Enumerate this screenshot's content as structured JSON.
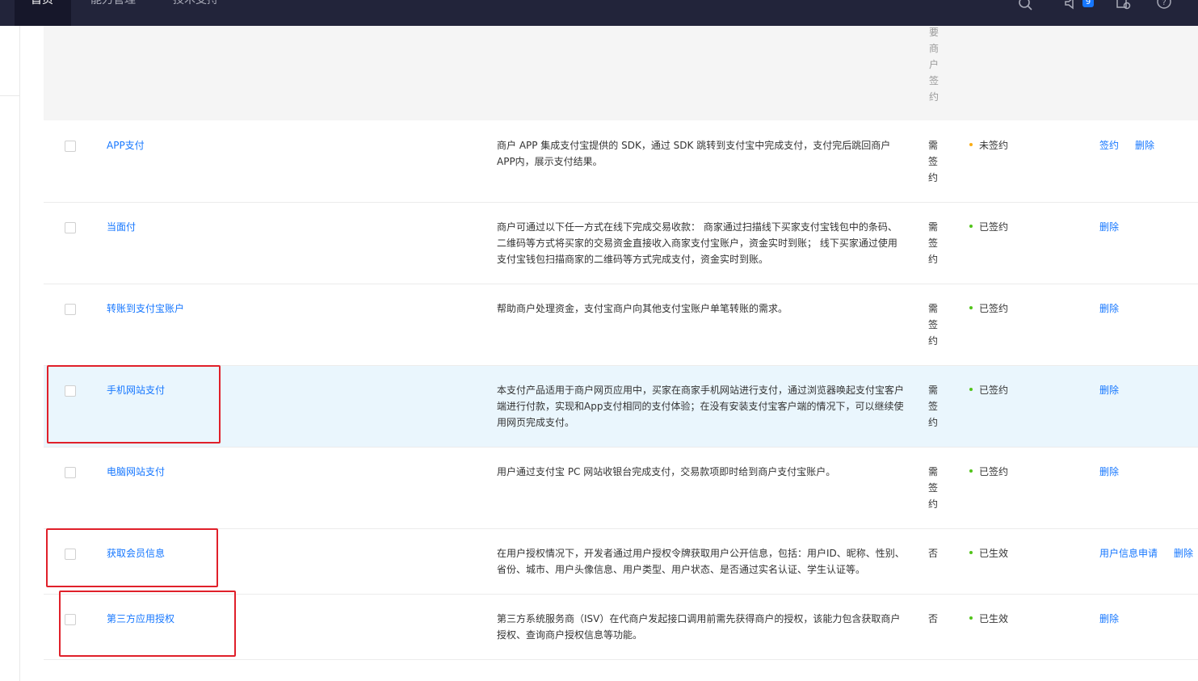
{
  "nav": {
    "items": [
      {
        "label": "首页",
        "active": true
      },
      {
        "label": "能力管理",
        "active": false
      },
      {
        "label": "技术支持",
        "active": false
      }
    ],
    "notification_count": "9",
    "icons": [
      "search-icon",
      "notification-icon",
      "document-settings-icon",
      "help-icon"
    ]
  },
  "table": {
    "header_sign_fragment": "要商户签约",
    "rows": [
      {
        "name": "APP支付",
        "desc": "商户 APP 集成支付宝提供的 SDK，通过 SDK 跳转到支付宝中完成支付，支付完后跳回商户 APP内，展示支付结果。",
        "sign": "需签约",
        "status": "未签约",
        "status_color": "#faad14",
        "ops": [
          "签约",
          "删除"
        ]
      },
      {
        "name": "当面付",
        "desc": "商户可通过以下任一方式在线下完成交易收款： 商家通过扫描线下买家支付宝钱包中的条码、二维码等方式将买家的交易资金直接收入商家支付宝账户，资金实时到账； 线下买家通过使用支付宝钱包扫描商家的二维码等方式完成支付，资金实时到账。",
        "sign": "需签约",
        "status": "已签约",
        "status_color": "#52c41a",
        "ops": [
          "删除"
        ]
      },
      {
        "name": "转账到支付宝账户",
        "desc": "帮助商户处理资金，支付宝商户向其他支付宝账户单笔转账的需求。",
        "sign": "需签约",
        "status": "已签约",
        "status_color": "#52c41a",
        "ops": [
          "删除"
        ]
      },
      {
        "name": "手机网站支付",
        "desc": "本支付产品适用于商户网页应用中，买家在商家手机网站进行支付，通过浏览器唤起支付宝客户端进行付款，实现和App支付相同的支付体验；在没有安装支付宝客户端的情况下，可以继续使用网页完成支付。",
        "sign": "需签约",
        "status": "已签约",
        "status_color": "#52c41a",
        "ops": [
          "删除"
        ]
      },
      {
        "name": "电脑网站支付",
        "desc": "用户通过支付宝 PC 网站收银台完成支付，交易款项即时给到商户支付宝账户。",
        "sign": "需签约",
        "status": "已签约",
        "status_color": "#52c41a",
        "ops": [
          "删除"
        ]
      },
      {
        "name": "获取会员信息",
        "desc": "在用户授权情况下，开发者通过用户授权令牌获取用户公开信息，包括：用户ID、昵称、性别、省份、城市、用户头像信息、用户类型、用户状态、是否通过实名认证、学生认证等。",
        "sign": "否",
        "status": "已生效",
        "status_color": "#52c41a",
        "ops": [
          "用户信息申请",
          "删除"
        ]
      },
      {
        "name": "第三方应用授权",
        "desc": "第三方系统服务商（ISV）在代商户发起接口调用前需先获得商户的授权，该能力包含获取商户授权、查询商户授权信息等功能。",
        "sign": "否",
        "status": "已生效",
        "status_color": "#52c41a",
        "ops": [
          "删除"
        ]
      }
    ]
  },
  "colors": {
    "topbar": "#22243a",
    "link": "#1677ff",
    "annotation": "#e0202a",
    "highlight_row": "#eaf6fd"
  }
}
